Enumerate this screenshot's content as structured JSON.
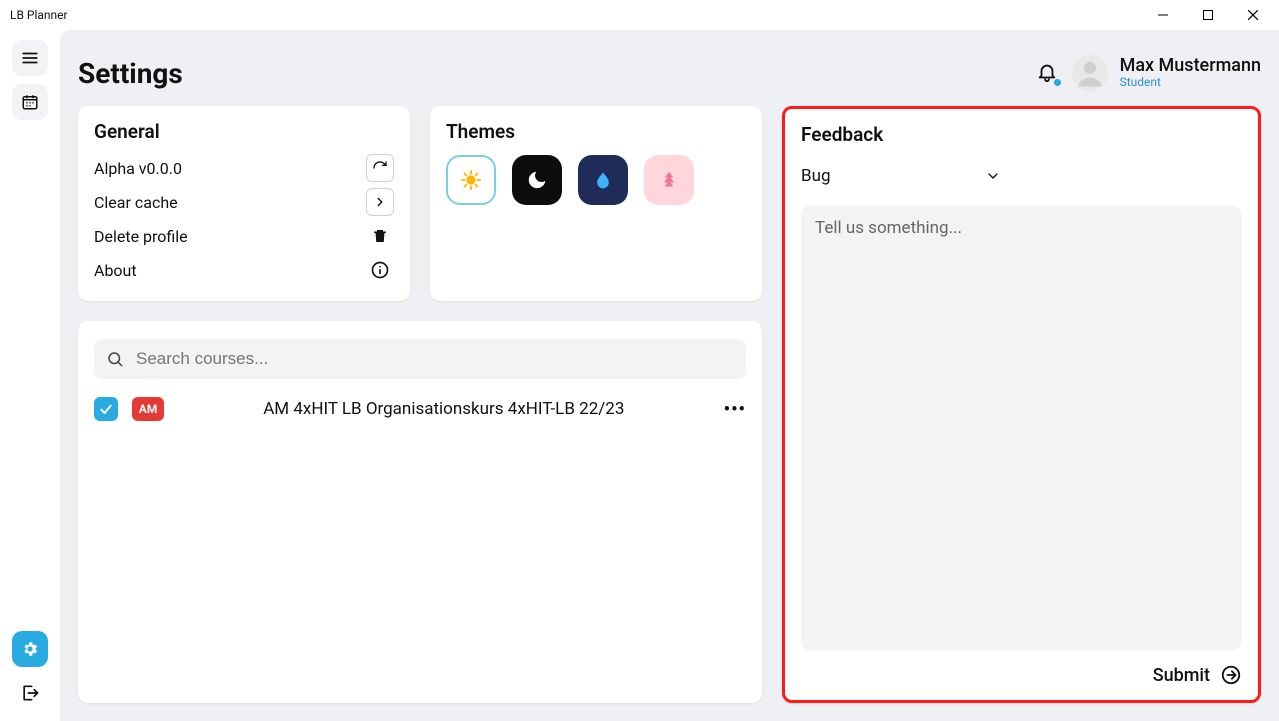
{
  "window": {
    "title": "LB Planner"
  },
  "header": {
    "page_title": "Settings",
    "user_name": "Max Mustermann",
    "user_role": "Student"
  },
  "general": {
    "title": "General",
    "version": "Alpha v0.0.0",
    "clear_cache": "Clear cache",
    "delete_profile": "Delete profile",
    "about": "About"
  },
  "themes": {
    "title": "Themes"
  },
  "feedback": {
    "title": "Feedback",
    "type_selected": "Bug",
    "placeholder": "Tell us something...",
    "submit_label": "Submit"
  },
  "courses": {
    "search_placeholder": "Search courses...",
    "items": [
      {
        "tag": "AM",
        "name": "AM 4xHIT LB Organisationskurs 4xHIT-LB 22/23",
        "checked": true
      }
    ]
  }
}
